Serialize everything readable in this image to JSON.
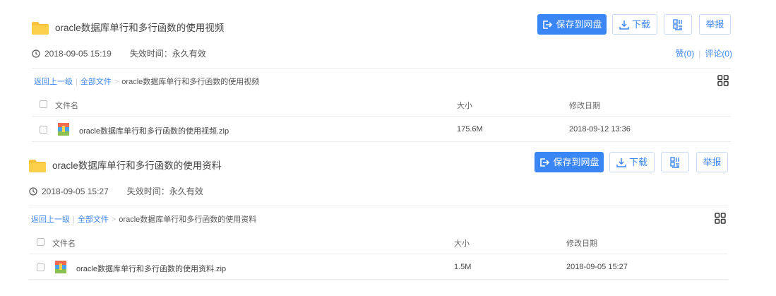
{
  "shares": [
    {
      "title": "oracle数据库单行和多行函数的使用视频",
      "save_label": "保存到网盘",
      "download_label": "下载",
      "report_label": "举报",
      "date": "2018-09-05 15:19",
      "expire_label": "失效时间：永久有效",
      "likes_label": "赞(0)",
      "comments_label": "评论(0)",
      "breadcrumb": {
        "back": "返回上一级",
        "all": "全部文件",
        "current": "oracle数据库单行和多行函数的使用视频"
      },
      "columns": {
        "name": "文件名",
        "size": "大小",
        "date": "修改日期"
      },
      "files": [
        {
          "name": "oracle数据库单行和多行函数的使用视频.zip",
          "size": "175.6M",
          "date": "2018-09-12 13:36"
        }
      ]
    },
    {
      "title": "oracle数据库单行和多行函数的使用资料",
      "save_label": "保存到网盘",
      "download_label": "下载",
      "report_label": "举报",
      "date": "2018-09-05 15:27",
      "expire_label": "失效时间：永久有效",
      "breadcrumb": {
        "back": "返回上一级",
        "all": "全部文件",
        "current": "oracle数据库单行和多行函数的使用资料"
      },
      "columns": {
        "name": "文件名",
        "size": "大小",
        "date": "修改日期"
      },
      "files": [
        {
          "name": "oracle数据库单行和多行函数的使用资料.zip",
          "size": "1.5M",
          "date": "2018-09-05 15:27"
        }
      ]
    }
  ],
  "colors": {
    "accent": "#3b86f5",
    "folder": "#f7c23c"
  },
  "icons": [
    "folder-icon",
    "save-icon",
    "download-icon",
    "qr-icon",
    "clock-icon",
    "grid-view-icon",
    "zip-file-icon"
  ]
}
